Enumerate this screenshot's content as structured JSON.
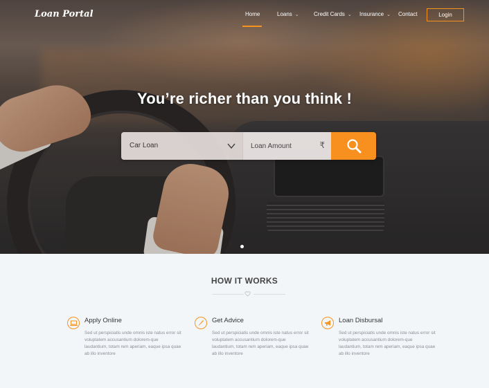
{
  "brand": {
    "logo_text": "Loan Portal",
    "accent_color": "#f7931e"
  },
  "nav": {
    "items": [
      {
        "label": "Home",
        "active": true,
        "has_dropdown": false
      },
      {
        "label": "Loans",
        "active": false,
        "has_dropdown": true
      },
      {
        "label": "Credit Cards",
        "active": false,
        "has_dropdown": true
      },
      {
        "label": "Insurance",
        "active": false,
        "has_dropdown": true
      },
      {
        "label": "Contact",
        "active": false,
        "has_dropdown": false
      }
    ],
    "dropdown_icon": "chevron-down-icon",
    "login_label": "Login"
  },
  "hero": {
    "headline": "You’re richer than you think !",
    "search": {
      "loan_type_value": "Car Loan",
      "loan_type_icon": "chevron-down-icon",
      "amount_placeholder": "Loan Amount",
      "currency_symbol": "₹",
      "submit_icon": "search-icon"
    },
    "slider_dots": 1
  },
  "how_it_works": {
    "title": "HOW IT WORKS",
    "divider_icon": "heart-icon",
    "features": [
      {
        "title": "Apply Online",
        "icon": "laptop-icon",
        "description": "Sed ut perspiciatis unde omnis iste natus error sit voluptatem accusantium dolorem-que laudantium, totam rem aperiam, eaque ipsa quae ab illo inventore"
      },
      {
        "title": "Get Advice",
        "icon": "pencil-icon",
        "description": "Sed ut perspiciatis unde omnis iste natus error sit voluptatem accusantium dolorem-que laudantium, totam rem aperiam, eaque ipsa quae ab illo inventore"
      },
      {
        "title": "Loan Disbursal",
        "icon": "megaphone-icon",
        "description": "Sed ut perspiciatis unde omnis iste natus error sit voluptatem accusantium dolorem-que laudantium, totam rem aperiam, eaque ipsa quae ab illo inventore"
      }
    ]
  }
}
